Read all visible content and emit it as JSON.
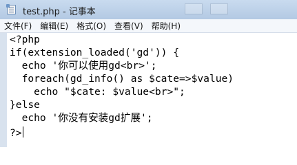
{
  "window": {
    "title": "test.php - 记事本"
  },
  "menu": {
    "items": [
      {
        "label": "文件(F)"
      },
      {
        "label": "编辑(E)"
      },
      {
        "label": "格式(O)"
      },
      {
        "label": "查看(V)"
      },
      {
        "label": "帮助(H)"
      }
    ]
  },
  "editor": {
    "lines": [
      "<?php",
      "if(extension_loaded('gd')) {",
      "  echo '你可以使用gd<br>';",
      "  foreach(gd_info() as $cate=>$value)",
      "    echo \"$cate: $value<br>\";",
      "}else",
      "  echo '你没有安装gd扩展';",
      "?>"
    ]
  }
}
